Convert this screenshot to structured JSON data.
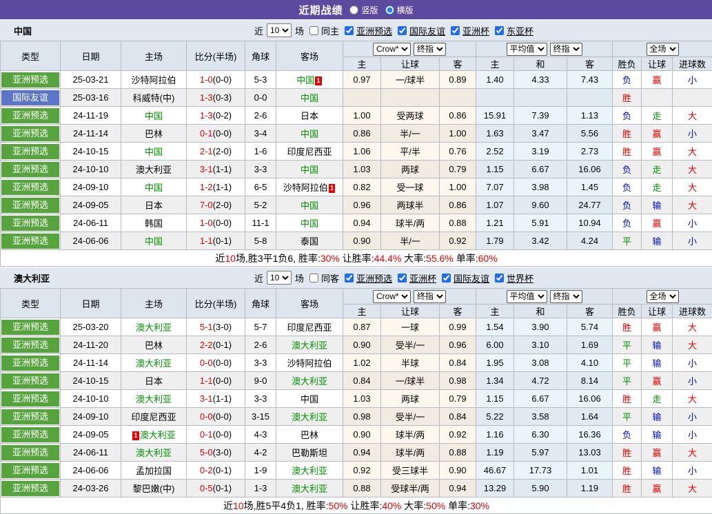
{
  "title_bar": {
    "title": "近期战绩",
    "radios": [
      {
        "label": "竖版",
        "checked": false
      },
      {
        "label": "横版",
        "checked": true
      }
    ]
  },
  "columns": {
    "left": [
      "类型",
      "日期",
      "主场",
      "比分(半场)",
      "角球",
      "客场"
    ],
    "selects": {
      "g1a": "Crow*",
      "g1b": "终指",
      "g2a": "平均值",
      "g2b": "终指",
      "g3": "全场"
    },
    "sub": [
      "主",
      "让球",
      "客",
      "主",
      "和",
      "客",
      "胜负",
      "让球",
      "进球数"
    ]
  },
  "colors": {
    "accent_purple": "#5b4a9e",
    "badge_green": "#57a43f",
    "badge_blue": "#5b76c8",
    "text_red": "#e60000",
    "text_green": "#009000",
    "text_blue": "#0008cc"
  },
  "result_color_map": {
    "胜": "red",
    "平": "green",
    "负": "blue",
    "赢": "red",
    "走": "green",
    "输": "blue",
    "大": "red",
    "小": "blue"
  },
  "tables": [
    {
      "team": "中国",
      "filter": {
        "near": "近",
        "count": "10",
        "unit": "场",
        "same": "同主",
        "same_checked": false,
        "leagues": [
          {
            "label": "亚洲预选",
            "checked": true
          },
          {
            "label": "国际友谊",
            "checked": true
          },
          {
            "label": "亚洲杯",
            "checked": true
          },
          {
            "label": "东亚杯",
            "checked": true
          }
        ]
      },
      "rows": [
        {
          "type": "亚洲预选",
          "tc": "g",
          "date": "25-03-21",
          "home": "沙特阿拉伯",
          "score": "1-0",
          "half": "(0-0)",
          "corner": "5-3",
          "away": "中国",
          "ag": true,
          "ab": "1",
          "abp": "after",
          "odds": [
            "0.97",
            "一/球半",
            "0.89"
          ],
          "avg": [
            "1.40",
            "4.33",
            "7.43"
          ],
          "res": [
            "负",
            "赢",
            "小"
          ]
        },
        {
          "type": "国际友谊",
          "tc": "b",
          "date": "25-03-16",
          "home": "科威特(中)",
          "score": "1-3",
          "half": "(0-3)",
          "corner": "0-0",
          "away": "中国",
          "ag": true,
          "odds": [
            "",
            "",
            ""
          ],
          "avg": [
            "",
            "",
            ""
          ],
          "res": [
            "胜",
            "",
            ""
          ]
        },
        {
          "type": "亚洲预选",
          "tc": "g",
          "date": "24-11-19",
          "home": "中国",
          "hg": true,
          "score": "1-3",
          "half": "(0-2)",
          "corner": "2-6",
          "away": "日本",
          "odds": [
            "1.00",
            "受两球",
            "0.86"
          ],
          "avg": [
            "15.91",
            "7.39",
            "1.13"
          ],
          "res": [
            "负",
            "走",
            "大"
          ]
        },
        {
          "type": "亚洲预选",
          "tc": "g",
          "date": "24-11-14",
          "home": "巴林",
          "score": "0-1",
          "half": "(0-0)",
          "corner": "3-4",
          "away": "中国",
          "ag": true,
          "odds": [
            "0.86",
            "半/一",
            "1.00"
          ],
          "avg": [
            "1.63",
            "3.47",
            "5.56"
          ],
          "res": [
            "胜",
            "赢",
            "小"
          ]
        },
        {
          "type": "亚洲预选",
          "tc": "g",
          "date": "24-10-15",
          "home": "中国",
          "hg": true,
          "score": "2-1",
          "half": "(2-0)",
          "corner": "1-6",
          "away": "印度尼西亚",
          "odds": [
            "1.06",
            "平/半",
            "0.76"
          ],
          "avg": [
            "2.52",
            "3.19",
            "2.73"
          ],
          "res": [
            "胜",
            "赢",
            "大"
          ]
        },
        {
          "type": "亚洲预选",
          "tc": "g",
          "date": "24-10-10",
          "home": "澳大利亚",
          "score": "3-1",
          "half": "(1-1)",
          "corner": "3-3",
          "away": "中国",
          "ag": true,
          "odds": [
            "1.03",
            "两球",
            "0.79"
          ],
          "avg": [
            "1.15",
            "6.67",
            "16.06"
          ],
          "res": [
            "负",
            "走",
            "大"
          ]
        },
        {
          "type": "亚洲预选",
          "tc": "g",
          "date": "24-09-10",
          "home": "中国",
          "hg": true,
          "score": "1-2",
          "half": "(1-1)",
          "corner": "6-5",
          "away": "沙特阿拉伯",
          "ab": "1",
          "abp": "after",
          "odds": [
            "0.82",
            "受一球",
            "1.00"
          ],
          "avg": [
            "7.07",
            "3.98",
            "1.45"
          ],
          "res": [
            "负",
            "走",
            "大"
          ]
        },
        {
          "type": "亚洲预选",
          "tc": "g",
          "date": "24-09-05",
          "home": "日本",
          "score": "7-0",
          "half": "(2-0)",
          "corner": "5-2",
          "away": "中国",
          "ag": true,
          "odds": [
            "0.96",
            "两球半",
            "0.86"
          ],
          "avg": [
            "1.07",
            "9.60",
            "24.77"
          ],
          "res": [
            "负",
            "输",
            "大"
          ]
        },
        {
          "type": "亚洲预选",
          "tc": "g",
          "date": "24-06-11",
          "home": "韩国",
          "score": "1-0",
          "half": "(0-0)",
          "corner": "11-1",
          "away": "中国",
          "ag": true,
          "odds": [
            "0.94",
            "球半/两",
            "0.88"
          ],
          "avg": [
            "1.21",
            "5.91",
            "10.94"
          ],
          "res": [
            "负",
            "赢",
            "小"
          ]
        },
        {
          "type": "亚洲预选",
          "tc": "g",
          "date": "24-06-06",
          "home": "中国",
          "hg": true,
          "score": "1-1",
          "half": "(0-1)",
          "corner": "5-8",
          "away": "泰国",
          "odds": [
            "0.90",
            "半/一",
            "0.92"
          ],
          "avg": [
            "1.79",
            "3.42",
            "4.24"
          ],
          "res": [
            "平",
            "输",
            "小"
          ]
        }
      ],
      "summary": [
        {
          "t": "近"
        },
        {
          "t": "10",
          "r": true
        },
        {
          "t": "场,胜3平1负6, 胜率:"
        },
        {
          "t": "30%",
          "r": true
        },
        {
          "t": " 让胜率:"
        },
        {
          "t": "44.4%",
          "r": true
        },
        {
          "t": " 大率:"
        },
        {
          "t": "55.6%",
          "r": true
        },
        {
          "t": " 单率:"
        },
        {
          "t": "60%",
          "r": true
        }
      ]
    },
    {
      "team": "澳大利亚",
      "filter": {
        "near": "近",
        "count": "10",
        "unit": "场",
        "same": "同客",
        "same_checked": false,
        "leagues": [
          {
            "label": "亚洲预选",
            "checked": true
          },
          {
            "label": "亚洲杯",
            "checked": true
          },
          {
            "label": "国际友谊",
            "checked": true
          },
          {
            "label": "世界杯",
            "checked": true
          }
        ]
      },
      "rows": [
        {
          "type": "亚洲预选",
          "tc": "g",
          "date": "25-03-20",
          "home": "澳大利亚",
          "hg": true,
          "score": "5-1",
          "half": "(3-0)",
          "corner": "5-7",
          "away": "印度尼西亚",
          "odds": [
            "0.87",
            "一球",
            "0.99"
          ],
          "avg": [
            "1.54",
            "3.90",
            "5.74"
          ],
          "res": [
            "胜",
            "赢",
            "大"
          ]
        },
        {
          "type": "亚洲预选",
          "tc": "g",
          "date": "24-11-20",
          "home": "巴林",
          "score": "2-2",
          "half": "(0-1)",
          "corner": "2-6",
          "away": "澳大利亚",
          "ag": true,
          "odds": [
            "0.90",
            "受半/一",
            "0.96"
          ],
          "avg": [
            "6.00",
            "3.10",
            "1.69"
          ],
          "res": [
            "平",
            "输",
            "大"
          ]
        },
        {
          "type": "亚洲预选",
          "tc": "g",
          "date": "24-11-14",
          "home": "澳大利亚",
          "hg": true,
          "score": "0-0",
          "half": "(0-0)",
          "corner": "3-3",
          "away": "沙特阿拉伯",
          "odds": [
            "1.02",
            "半球",
            "0.84"
          ],
          "avg": [
            "1.95",
            "3.08",
            "4.10"
          ],
          "res": [
            "平",
            "输",
            "小"
          ]
        },
        {
          "type": "亚洲预选",
          "tc": "g",
          "date": "24-10-15",
          "home": "日本",
          "score": "1-1",
          "half": "(0-0)",
          "corner": "9-0",
          "away": "澳大利亚",
          "ag": true,
          "odds": [
            "0.84",
            "一/球半",
            "0.98"
          ],
          "avg": [
            "1.34",
            "4.72",
            "8.14"
          ],
          "res": [
            "平",
            "赢",
            "小"
          ]
        },
        {
          "type": "亚洲预选",
          "tc": "g",
          "date": "24-10-10",
          "home": "澳大利亚",
          "hg": true,
          "score": "3-1",
          "half": "(1-1)",
          "corner": "3-3",
          "away": "中国",
          "odds": [
            "1.03",
            "两球",
            "0.79"
          ],
          "avg": [
            "1.15",
            "6.67",
            "16.06"
          ],
          "res": [
            "胜",
            "走",
            "大"
          ]
        },
        {
          "type": "亚洲预选",
          "tc": "g",
          "date": "24-09-10",
          "home": "印度尼西亚",
          "score": "0-0",
          "half": "(0-0)",
          "corner": "3-15",
          "away": "澳大利亚",
          "ag": true,
          "odds": [
            "0.98",
            "受半/一",
            "0.84"
          ],
          "avg": [
            "5.22",
            "3.58",
            "1.64"
          ],
          "res": [
            "平",
            "输",
            "小"
          ]
        },
        {
          "type": "亚洲预选",
          "tc": "g",
          "date": "24-09-05",
          "home": "澳大利亚",
          "hg": true,
          "hb": "1",
          "hbp": "before",
          "score": "0-1",
          "half": "(0-0)",
          "corner": "4-3",
          "away": "巴林",
          "odds": [
            "0.90",
            "球半/两",
            "0.92"
          ],
          "avg": [
            "1.16",
            "6.30",
            "16.36"
          ],
          "res": [
            "负",
            "输",
            "小"
          ]
        },
        {
          "type": "亚洲预选",
          "tc": "g",
          "date": "24-06-11",
          "home": "澳大利亚",
          "hg": true,
          "score": "5-0",
          "half": "(3-0)",
          "corner": "4-2",
          "away": "巴勒斯坦",
          "odds": [
            "0.94",
            "球半/两",
            "0.88"
          ],
          "avg": [
            "1.19",
            "5.97",
            "13.03"
          ],
          "res": [
            "胜",
            "赢",
            "大"
          ]
        },
        {
          "type": "亚洲预选",
          "tc": "g",
          "date": "24-06-06",
          "home": "孟加拉国",
          "score": "0-2",
          "half": "(0-1)",
          "corner": "1-9",
          "away": "澳大利亚",
          "ag": true,
          "odds": [
            "0.92",
            "受三球半",
            "0.90"
          ],
          "avg": [
            "46.67",
            "17.73",
            "1.01"
          ],
          "res": [
            "胜",
            "输",
            "小"
          ]
        },
        {
          "type": "亚洲预选",
          "tc": "g",
          "date": "24-03-26",
          "home": "黎巴嫩(中)",
          "score": "0-5",
          "half": "(0-1)",
          "corner": "1-3",
          "away": "澳大利亚",
          "ag": true,
          "odds": [
            "0.88",
            "受球半/两",
            "0.94"
          ],
          "avg": [
            "13.29",
            "5.90",
            "1.19"
          ],
          "res": [
            "胜",
            "赢",
            "大"
          ]
        }
      ],
      "summary": [
        {
          "t": "近"
        },
        {
          "t": "10",
          "r": true
        },
        {
          "t": "场,胜5平4负1, 胜率:"
        },
        {
          "t": "50%",
          "r": true
        },
        {
          "t": " 让胜率:"
        },
        {
          "t": "40%",
          "r": true
        },
        {
          "t": " 大率:"
        },
        {
          "t": "50%",
          "r": true
        },
        {
          "t": " 单率:"
        },
        {
          "t": "30%",
          "r": true
        }
      ]
    }
  ]
}
